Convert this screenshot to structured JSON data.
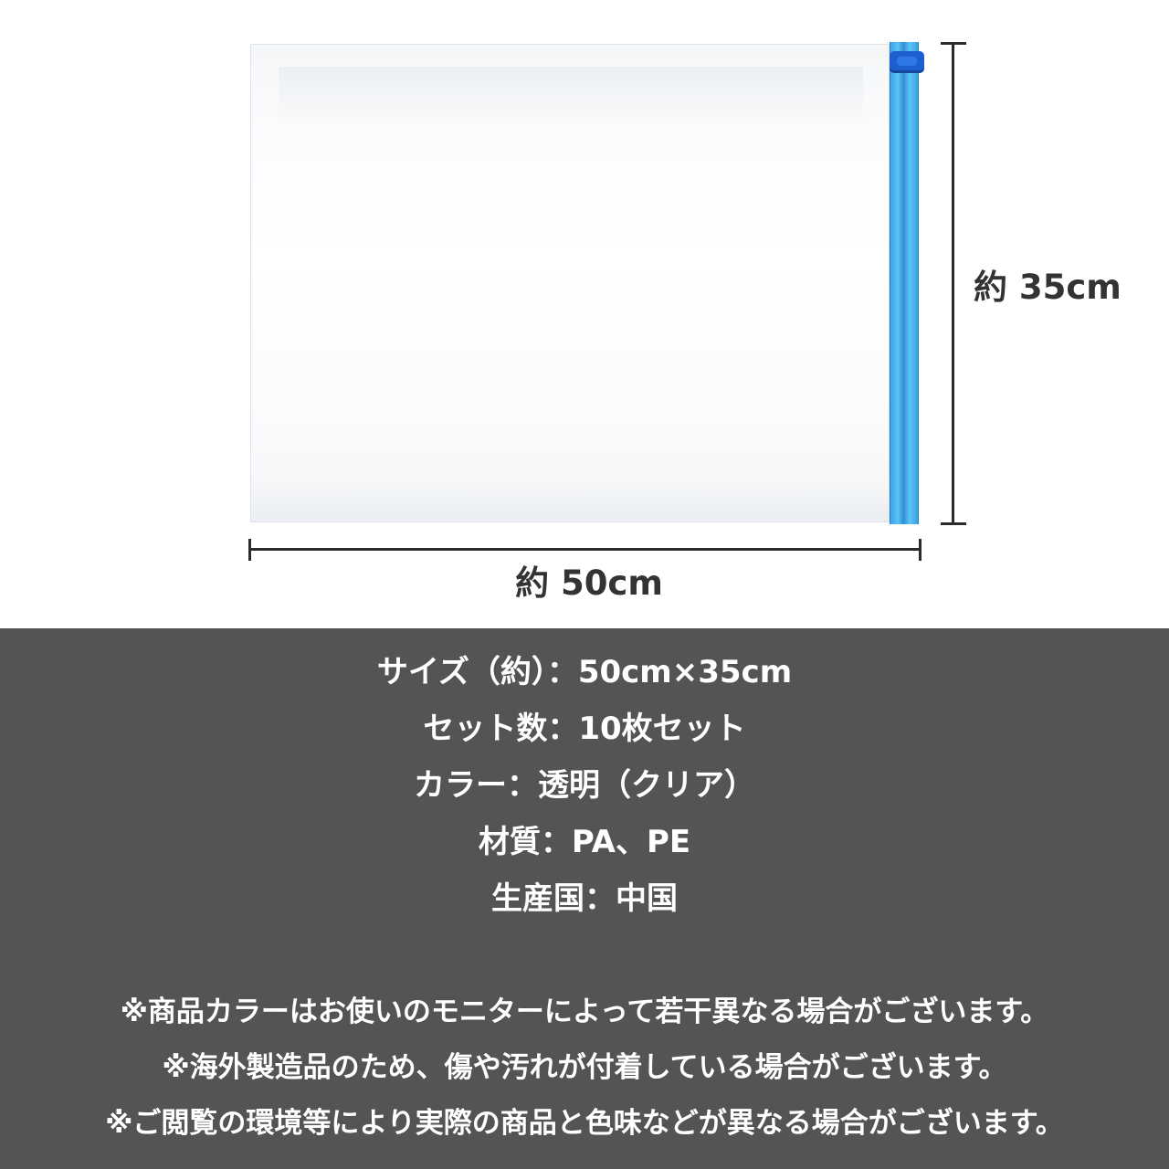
{
  "product": {
    "width_label": "約 50cm",
    "height_label": "約 35cm"
  },
  "colors": {
    "zipper": "#3ba6e6",
    "zipper_slider": "#1e5fcf",
    "panel_background": "#545454",
    "text_dark": "#333333",
    "text_light": "#ffffff"
  },
  "specs": [
    "サイズ（約）：50cm×35cm",
    "セット数：10枚セット",
    "カラー：透明（クリア）",
    "材質：PA、PE",
    "生産国：中国"
  ],
  "notes": [
    "※商品カラーはお使いのモニターによって若干異なる場合がございます。",
    "※海外製造品のため、傷や汚れが付着している場合がございます。",
    "※ご閲覧の環境等により実際の商品と色味などが異なる場合がございます。"
  ]
}
